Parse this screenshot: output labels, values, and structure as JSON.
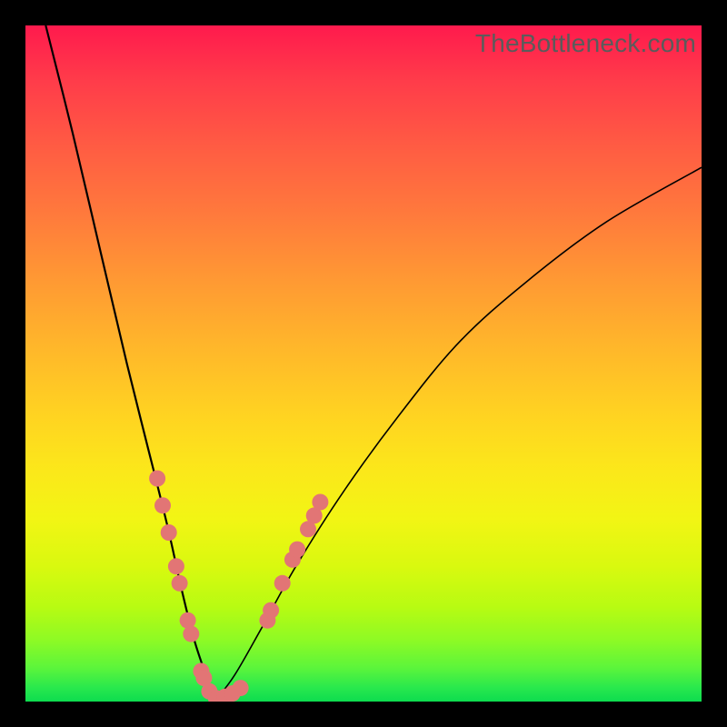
{
  "watermark": "TheBottleneck.com",
  "colors": {
    "background_frame": "#000000",
    "marker_fill": "#e27575",
    "curve_stroke": "#000000",
    "gradient_stops": [
      "#ff1a4d",
      "#ff3b4a",
      "#ff5c43",
      "#ff7a3c",
      "#ff9a33",
      "#ffb82a",
      "#ffd421",
      "#fbe81a",
      "#f2f514",
      "#d9f90f",
      "#b8fb12",
      "#8dfa25",
      "#5cf53b",
      "#28e84d",
      "#0ddc4f"
    ]
  },
  "chart_data": {
    "type": "line",
    "title": "",
    "xlabel": "",
    "ylabel": "",
    "xlim": [
      0,
      100
    ],
    "ylim": [
      0,
      100
    ],
    "description": "Single V-shaped curve: steep descent from top-left to a minimum near x≈28, y≈0, then slower rise toward upper-right, with marker clusters along both flanks and across the trough.",
    "series": [
      {
        "name": "curve_left",
        "x": [
          3,
          7,
          11,
          15,
          18,
          21,
          23,
          25,
          27,
          28
        ],
        "y": [
          100,
          84,
          67,
          50,
          38,
          26,
          17,
          9,
          3,
          0
        ]
      },
      {
        "name": "curve_right",
        "x": [
          28,
          31,
          35,
          40,
          47,
          55,
          64,
          74,
          86,
          100
        ],
        "y": [
          0,
          4,
          11,
          20,
          31,
          42,
          53,
          62,
          71,
          79
        ]
      }
    ],
    "markers": [
      {
        "x": 19.5,
        "y": 33
      },
      {
        "x": 20.3,
        "y": 29
      },
      {
        "x": 21.2,
        "y": 25
      },
      {
        "x": 22.3,
        "y": 20
      },
      {
        "x": 22.8,
        "y": 17.5
      },
      {
        "x": 24.0,
        "y": 12
      },
      {
        "x": 24.5,
        "y": 10
      },
      {
        "x": 26.0,
        "y": 4.5
      },
      {
        "x": 26.4,
        "y": 3.5
      },
      {
        "x": 27.2,
        "y": 1.5
      },
      {
        "x": 28.2,
        "y": 0.5
      },
      {
        "x": 29.5,
        "y": 0.7
      },
      {
        "x": 30.6,
        "y": 1.2
      },
      {
        "x": 31.8,
        "y": 2.0
      },
      {
        "x": 35.8,
        "y": 12
      },
      {
        "x": 36.3,
        "y": 13.5
      },
      {
        "x": 38.0,
        "y": 17.5
      },
      {
        "x": 39.5,
        "y": 21
      },
      {
        "x": 40.2,
        "y": 22.5
      },
      {
        "x": 41.8,
        "y": 25.5
      },
      {
        "x": 42.7,
        "y": 27.5
      },
      {
        "x": 43.6,
        "y": 29.5
      }
    ]
  }
}
